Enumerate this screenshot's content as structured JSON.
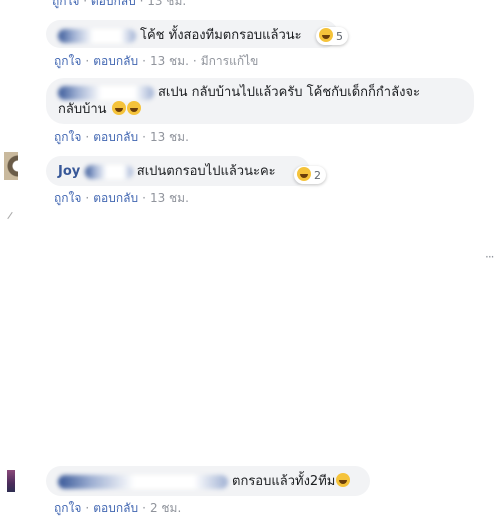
{
  "top_partial": {
    "like": "ถูกใจ",
    "reply": "ตอบกลับ",
    "time": "13 ชม."
  },
  "comments": [
    {
      "text": "โค้ช ทั้งสองทีมตกรอบแล้วนะ",
      "reaction": {
        "icon": "laugh-emoji-icon",
        "count": "5"
      },
      "actions": {
        "like": "ถูกใจ",
        "reply": "ตอบกลับ",
        "time": "13 ชม.",
        "edited": "มีการแก้ไข"
      }
    },
    {
      "text_line1": "สเปน กลับบ้านไปแล้วครับ โค้ชกับเด็กก็กำลังจะ",
      "text_line2": "กลับบ้าน",
      "actions": {
        "like": "ถูกใจ",
        "reply": "ตอบกลับ",
        "time": "13 ชม."
      }
    },
    {
      "name_visible": "Joy",
      "text": "สเปนตกรอบไปแล้วนะคะ",
      "reaction": {
        "icon": "laugh-emoji-icon",
        "count": "2"
      },
      "actions": {
        "like": "ถูกใจ",
        "reply": "ตอบกลับ",
        "time": "13 ชม."
      }
    },
    {
      "text": "ตกรอบแล้วทั้ง2ทีม",
      "actions": {
        "like": "ถูกใจ",
        "reply": "ตอบกลับ",
        "time": "2 ชม."
      }
    }
  ],
  "colors": {
    "bubble": "#f2f3f5",
    "link": "#4267b2",
    "name": "#385898",
    "meta": "#90949c"
  }
}
